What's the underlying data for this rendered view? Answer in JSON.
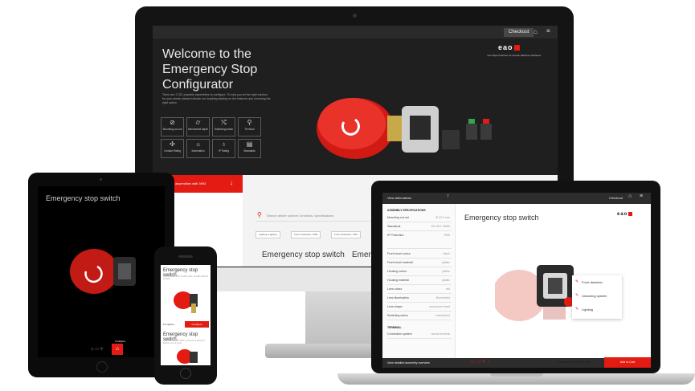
{
  "monitor": {
    "checkout_label": "Checkout",
    "brand": "eao",
    "tagline": "Your Expert Partner for Human Machine Interfaces",
    "welcome_title": "Welcome to the Emergency Stop Configurator",
    "intro_text": "There are 2 321 possible assemblies to configure. To help you let the right solution for your needs please indicate our inspiring starting on the features and choosing the right option.",
    "tiles": [
      {
        "label": "Mounting cut-out",
        "icon": "circle-slash-icon"
      },
      {
        "label": "Mechanical depth",
        "icon": "cylinder-icon"
      },
      {
        "label": "Switching action",
        "icon": "shuffle-icon"
      },
      {
        "label": "Terminal",
        "icon": "pin-icon"
      },
      {
        "label": "Contact Rating",
        "icon": "contact-icon"
      },
      {
        "label": "Illumination",
        "icon": "bulb-icon"
      },
      {
        "label": "IP Rating",
        "icon": "droplet-icon"
      },
      {
        "label": "Standards",
        "icon": "document-icon"
      }
    ],
    "promo_label": "assemblies with 3993",
    "search_placeholder": "Search article number, functions, specifications",
    "chips": [
      "Lighting: Lighting",
      "Front Protection: IP66",
      "Front Protection: IP67"
    ],
    "cards": [
      "Emergency stop switch",
      "Emer"
    ]
  },
  "tablet": {
    "title": "Emergency stop switch",
    "toolbar_label": "Configure"
  },
  "phone": {
    "title": "Emergency stop switch",
    "desc": "45.2000.1029 9000, 45.2001.2001, 45.2001.0000 45 00 1000",
    "options_label": "13 options",
    "configure_label": "Configure",
    "title2": "Emergency stop switch",
    "desc2": "Assembly: 45.2001.0001.5, Pictured is added the finishes sure of a part"
  },
  "laptop": {
    "view_alternatives_label": "View alternatives",
    "checkout_label": "Checkout",
    "brand": "eao",
    "spec_header": "ASSEMBLY SPECIFICATIONS",
    "spec_rows": [
      {
        "label": "Mounting cut-out",
        "value": "Ø 22.3 mm"
      },
      {
        "label": "Standards",
        "value": "EN ISO 13850"
      },
      {
        "label": "IP Protection",
        "value": "IP65"
      },
      {
        "label": "Front bezel colour",
        "value": "black"
      },
      {
        "label": "Front bezel material",
        "value": "plastic"
      },
      {
        "label": "Housing colour",
        "value": "yellow"
      },
      {
        "label": "Housing material",
        "value": "plastic"
      },
      {
        "label": "Lens colour",
        "value": "red"
      },
      {
        "label": "Lens illumination",
        "value": "illuminated"
      },
      {
        "label": "Lens shape",
        "value": "mushroom head"
      },
      {
        "label": "Switching action",
        "value": "maintained"
      }
    ],
    "terminal_header": "TERMINAL",
    "terminal_row": {
      "label": "Connection system",
      "value": "screw terminal"
    },
    "product_title": "Emergency stop switch",
    "menu_items": [
      "Front diameter",
      "Unlocking system",
      "Lighting"
    ],
    "footer_label": "View detailed assembly overview",
    "assembly_price": "Assembly for 118.50 CHF",
    "add_to_cart_label": "Add to Cart"
  },
  "colors": {
    "accent": "#e41b13",
    "dark": "#1f1f1f"
  }
}
